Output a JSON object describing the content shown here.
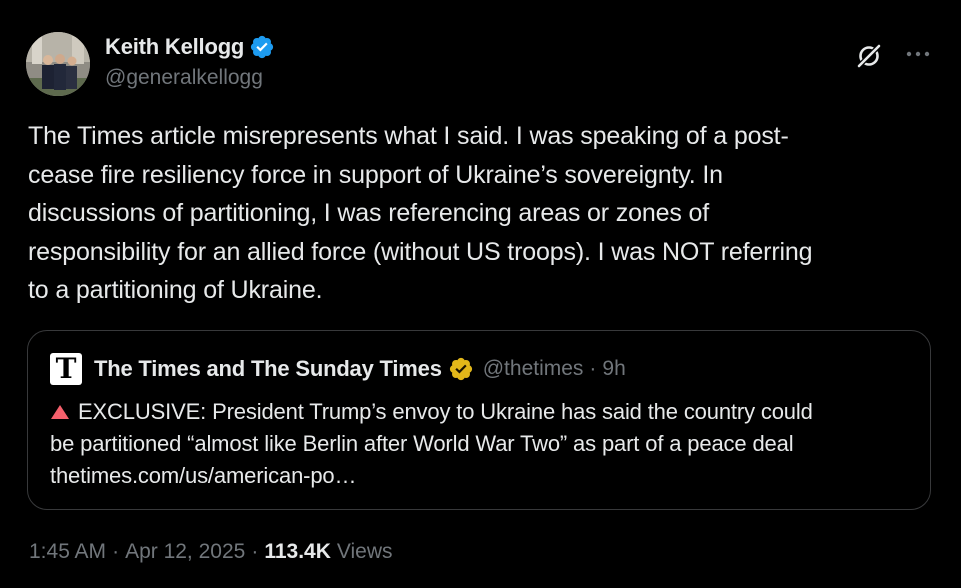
{
  "author": {
    "display_name": "Keith Kellogg",
    "handle": "@generalkellogg",
    "verified_color": "#1d9bf0"
  },
  "header_actions": {
    "grok_icon": "grok-icon",
    "more_icon": "more-icon"
  },
  "tweet": {
    "text": "The Times article misrepresents what I said. I was speaking of a post-\ncease fire resiliency force in support of Ukraine’s sovereignty. In\ndiscussions of partitioning, I was referencing areas or zones of\nresponsibility for an allied force (without US troops). I was NOT referring\nto a partitioning of Ukraine."
  },
  "quote": {
    "logo_letter": "T",
    "display_name": "The Times and The Sunday Times",
    "handle": "@thetimes",
    "separator": "·",
    "time": "9h",
    "badge_color": "#e2b719",
    "text": "EXCLUSIVE: President Trump’s envoy to Ukraine has said the country could\nbe partitioned “almost like Berlin after World War Two” as part of a peace deal\nthetimes.com/us/american-po…",
    "emoji": "red-triangle-icon"
  },
  "meta": {
    "time": "1:45 AM",
    "date": "Apr 12, 2025",
    "separator": "·",
    "views_count": "113.4K",
    "views_label": "Views"
  },
  "colors": {
    "background": "#000000",
    "text_primary": "#e7e9ea",
    "text_secondary": "#71767b",
    "border": "#38393b"
  }
}
